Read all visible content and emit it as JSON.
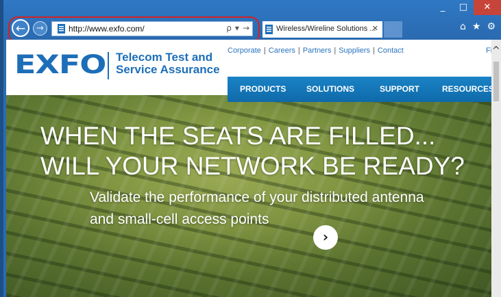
{
  "window": {
    "minimize": "_",
    "maximize": "□",
    "close": "✕"
  },
  "browser": {
    "back_icon": "back-arrow-icon",
    "forward_icon": "forward-arrow-icon",
    "url": "http://www.exfo.com/",
    "address_icons": [
      "ρ",
      "▾",
      "→"
    ],
    "tab_title": "Wireless/Wireline Solutions ...",
    "tab_close": "✕",
    "toolbar_icons": [
      "⌂",
      "★",
      "⚙"
    ],
    "highlight_color": "#d42126"
  },
  "site": {
    "logo": "EXFO",
    "tagline_line1": "Telecom Test and",
    "tagline_line2": "Service Assurance",
    "top_links": [
      "Corporate",
      "Careers",
      "Partners",
      "Suppliers",
      "Contact"
    ],
    "side_fragment": "Fi",
    "menu": [
      "PRODUCTS",
      "SOLUTIONS",
      "SUPPORT",
      "RESOURCES"
    ],
    "headline_line1": "WHEN THE SEATS ARE FILLED...",
    "headline_line2": "WILL YOUR NETWORK BE READY?",
    "subtext_line1": "Validate the performance of your distributed antenna",
    "subtext_line2": "and small-cell access points",
    "go_button": "›",
    "brand_color": "#1d6eb8",
    "menu_color": "#1a83c6"
  }
}
